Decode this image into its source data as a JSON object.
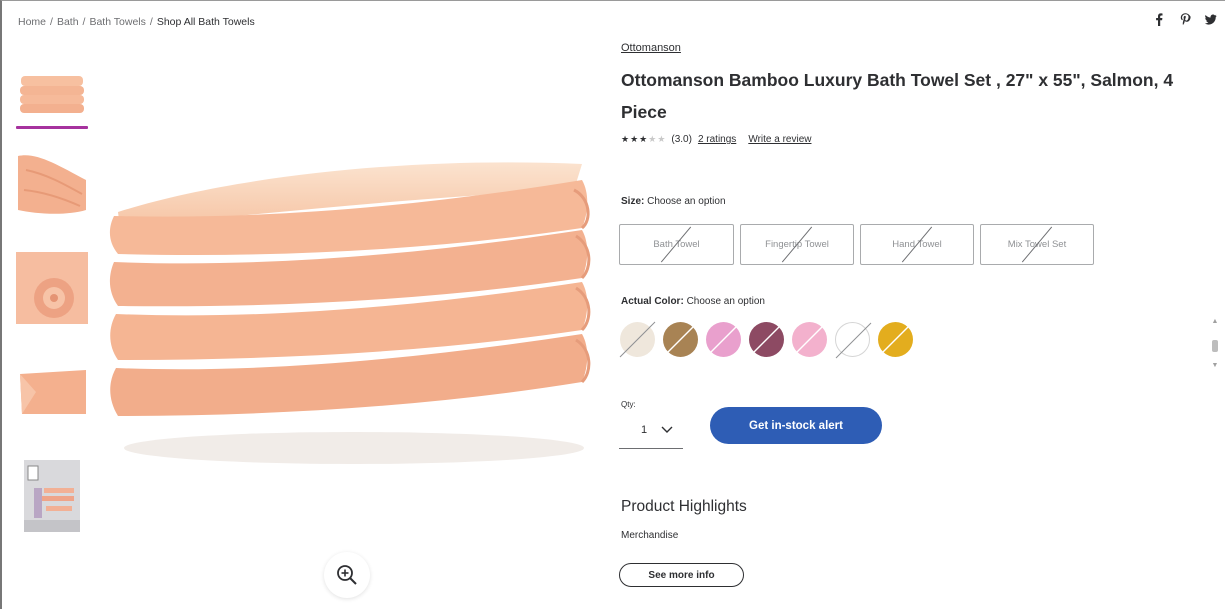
{
  "breadcrumb": {
    "items": [
      "Home",
      "Bath",
      "Bath Towels"
    ],
    "current": "Shop All Bath Towels",
    "separator": "/"
  },
  "social": {
    "icons": [
      "facebook-icon",
      "pinterest-icon",
      "twitter-icon"
    ]
  },
  "gallery": {
    "thumbnail_count": 5,
    "selected_index": 0,
    "accent_color": "#a6329e"
  },
  "product": {
    "brand": "Ottomanson",
    "title": "Ottomanson Bamboo Luxury Bath Towel Set , 27\" x 55\", Salmon, 4 Piece",
    "rating": {
      "stars_filled": 3,
      "stars_total": 5,
      "score_text": "(3.0)",
      "ratings_link": "2 ratings",
      "write_review": "Write a review"
    }
  },
  "size": {
    "label": "Size:",
    "prompt": "Choose an option",
    "options": [
      "Bath Towel",
      "Fingertip Towel",
      "Hand Towel",
      "Mix Towel Set"
    ]
  },
  "color": {
    "label": "Actual Color:",
    "prompt": "Choose an option",
    "swatches": [
      "#efe7dc",
      "#a88354",
      "#e9a0cd",
      "#8d4a63",
      "#f3b1cd",
      "#ffffff",
      "#e3ad1e"
    ]
  },
  "quantity": {
    "label": "Qty:",
    "value": "1"
  },
  "actions": {
    "instock_alert": "Get in-stock alert",
    "accent": "#2e5db5"
  },
  "highlights": {
    "title": "Product Highlights",
    "merchandise": "Merchandise",
    "see_more": "See more info"
  }
}
